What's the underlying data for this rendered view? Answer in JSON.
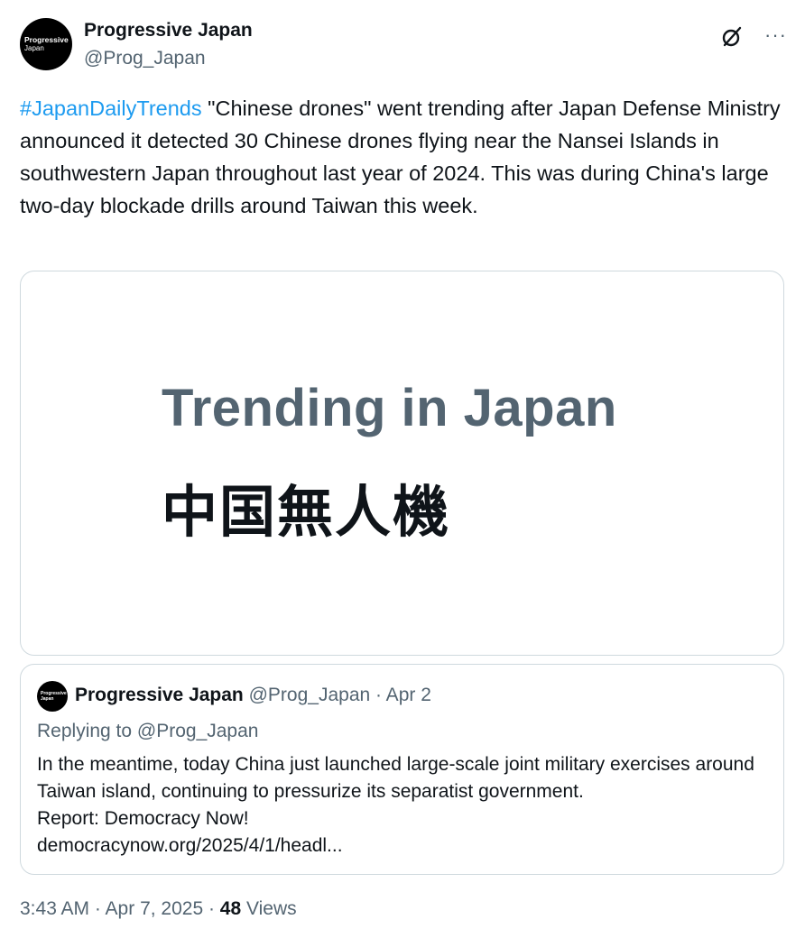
{
  "author": {
    "avatar_line1": "Progressive",
    "avatar_line2": "Japan",
    "display_name": "Progressive Japan",
    "handle": "@Prog_Japan"
  },
  "tweet": {
    "hashtag": "#JapanDailyTrends",
    "text": " \"Chinese drones\" went trending after Japan Defense Ministry announced it detected 30 Chinese drones flying near the Nansei Islands in southwestern Japan throughout last year of 2024. This was during China's large two-day blockade drills around Taiwan this week."
  },
  "media": {
    "title": "Trending in Japan",
    "subtitle": "中国無人機"
  },
  "quote": {
    "avatar_line1": "Progressive",
    "avatar_line2": "Japan",
    "display_name": "Progressive Japan",
    "meta": "@Prog_Japan · Apr 2",
    "replying_to": "Replying to @Prog_Japan",
    "body": "In the meantime, today China just launched large-scale joint military exercises around Taiwan island, continuing to pressurize its separatist government.\nReport: Democracy Now!\ndemocracynow.org/2025/4/1/headl..."
  },
  "footer": {
    "timestamp": "3:43 AM · Apr 7, 2025 · ",
    "views_count": "48",
    "views_label": " Views"
  },
  "icons": {
    "grok": "grok-icon",
    "more": "more-icon"
  }
}
